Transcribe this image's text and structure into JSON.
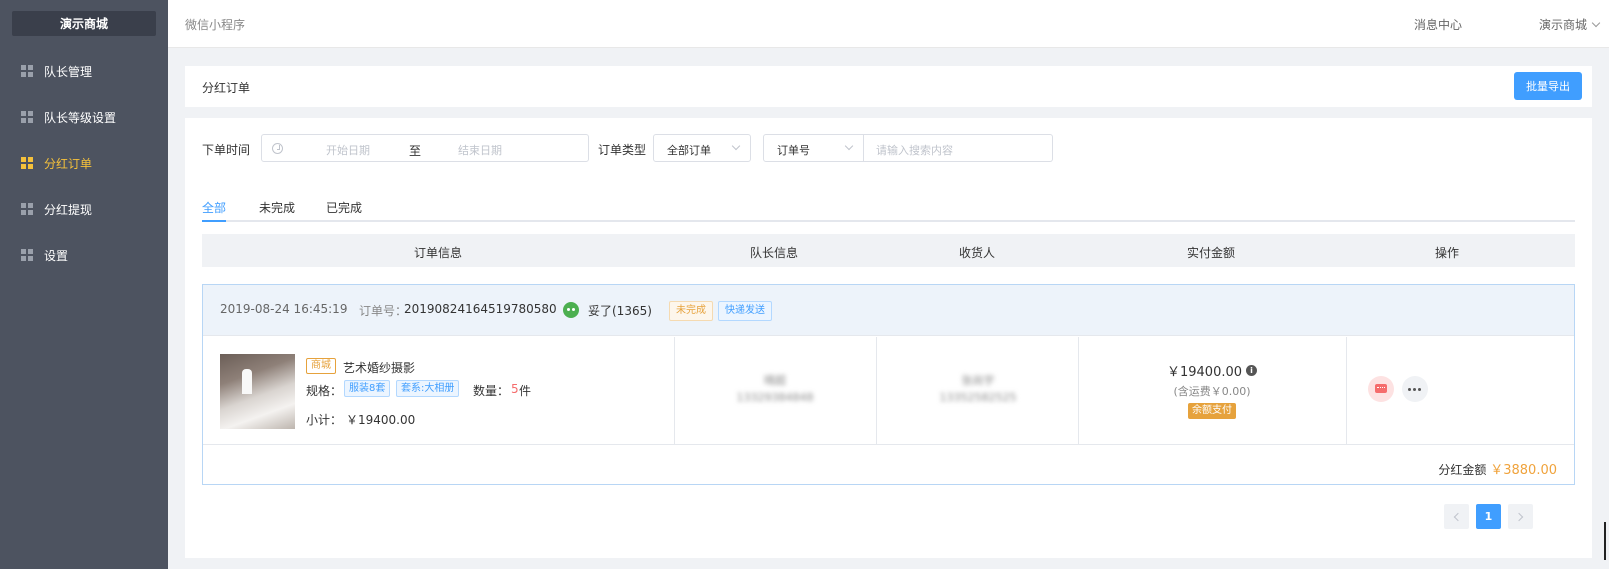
{
  "sidebar": {
    "brand": "演示商城",
    "items": [
      {
        "label": "队长管理",
        "active": false
      },
      {
        "label": "队长等级设置",
        "active": false
      },
      {
        "label": "分红订单",
        "active": true
      },
      {
        "label": "分红提现",
        "active": false
      },
      {
        "label": "设置",
        "active": false
      }
    ]
  },
  "header": {
    "title": "微信小程序",
    "message_center": "消息中心",
    "user_menu": "演示商城"
  },
  "page": {
    "title": "分红订单",
    "export_button": "批量导出"
  },
  "filters": {
    "time_label": "下单时间",
    "start_placeholder": "开始日期",
    "range_separator": "至",
    "end_placeholder": "结束日期",
    "type_label": "订单类型",
    "type_value": "全部订单",
    "search_field": "订单号",
    "search_placeholder": "请输入搜索内容"
  },
  "tabs": [
    {
      "label": "全部",
      "active": true
    },
    {
      "label": "未完成",
      "active": false
    },
    {
      "label": "已完成",
      "active": false
    }
  ],
  "table": {
    "headers": [
      "订单信息",
      "队长信息",
      "收货人",
      "实付金额",
      "操作"
    ]
  },
  "order": {
    "time": "2019-08-24 16:45:19",
    "order_no_label": "订单号：",
    "order_no": "20190824164519780580",
    "user": "妥了(1365)",
    "status_tag": "未完成",
    "delivery_tag": "快递发送",
    "product": {
      "source_tag": "商城",
      "name": "艺术婚纱摄影",
      "spec_label": "规格：",
      "specs": [
        "服装8套",
        "套系:大相册"
      ],
      "qty_label": "数量：",
      "qty": "5",
      "qty_unit": "件",
      "subtotal_label": "小计：",
      "subtotal": "￥19400.00"
    },
    "leader": {
      "name": "晴超",
      "phone": "13329384848"
    },
    "receiver": {
      "name": "张尚宇",
      "phone": "13352582525"
    },
    "paid": {
      "amount": "￥19400.00",
      "shipping": "(含运费￥0.00)",
      "pay_method": "余额支付"
    },
    "dividend_label": "分红金额",
    "dividend_amount": "￥3880.00"
  },
  "pagination": {
    "current": "1"
  },
  "colors": {
    "sidebar_bg": "#4d5360",
    "active_nav": "#f5c13b",
    "primary": "#409eff",
    "warning": "#e6a23c",
    "danger": "#f56c6c"
  }
}
